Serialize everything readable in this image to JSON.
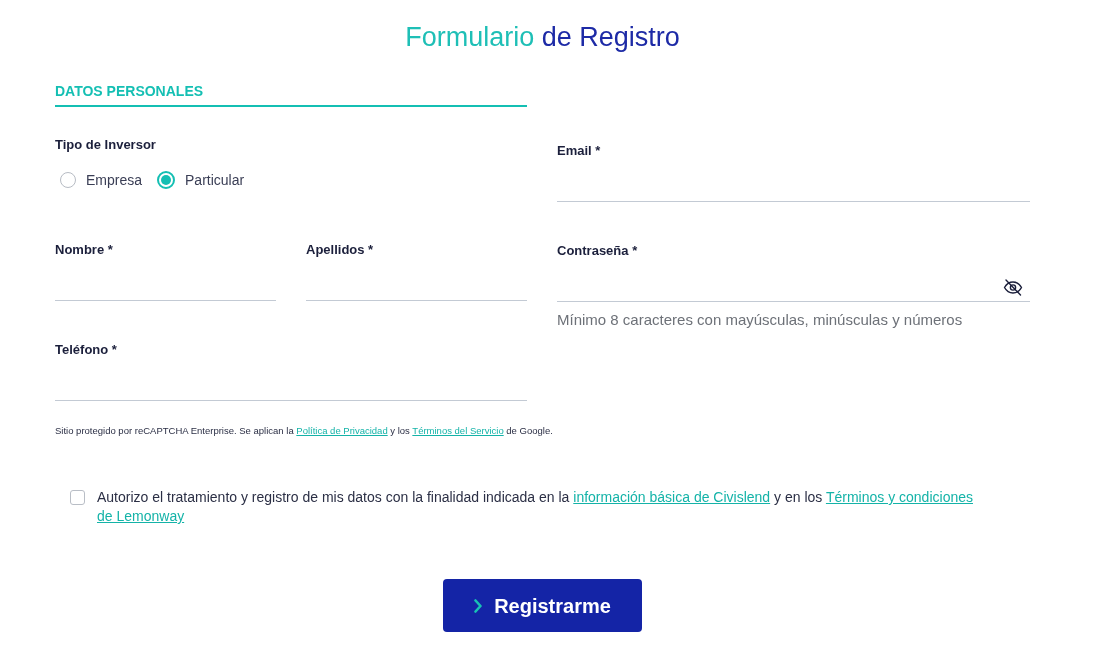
{
  "title": {
    "accent": "Formulario",
    "main": "de Registro"
  },
  "section_heading": "DATOS PERSONALES",
  "investor_type": {
    "label": "Tipo de Inversor",
    "options": [
      {
        "label": "Empresa",
        "selected": false
      },
      {
        "label": "Particular",
        "selected": true
      }
    ]
  },
  "email_field": {
    "label": "Email *"
  },
  "name_fields": [
    {
      "label": "Nombre *"
    },
    {
      "label": "Apellidos *"
    }
  ],
  "password_field": {
    "label": "Contraseña *",
    "hint": "Mínimo 8 caracteres con mayúsculas, minúsculas y números"
  },
  "phone_field": {
    "label": "Teléfono *"
  },
  "recaptcha_notice": [
    {
      "kind": "text",
      "text": "Sitio protegido por reCAPTCHA Enterprise. Se aplican la"
    },
    {
      "kind": "link",
      "text": "Política de Privacidad"
    },
    {
      "kind": "text",
      "text": "y los"
    },
    {
      "kind": "link",
      "text": "Términos del Servicio"
    },
    {
      "kind": "text",
      "text": "de Google."
    }
  ],
  "consent": {
    "checked": false,
    "segments": [
      {
        "kind": "text",
        "text": "Autorizo el tratamiento y registro de mis datos con la finalidad indicada en la"
      },
      {
        "kind": "link",
        "text": "información básica de Civislend"
      },
      {
        "kind": "text",
        "text": "y en los"
      },
      {
        "kind": "link",
        "text": "Términos y condiciones"
      },
      {
        "kind": "link",
        "text": "de Lemonway"
      }
    ]
  },
  "submit_button": {
    "label": "Registrarme"
  }
}
